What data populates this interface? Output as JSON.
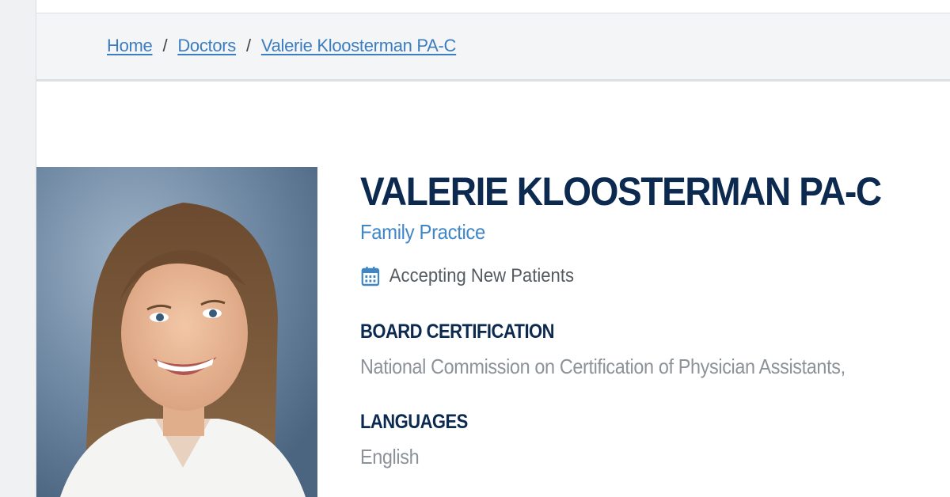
{
  "breadcrumb": {
    "items": [
      "Home",
      "Doctors",
      "Valerie Kloosterman PA-C"
    ],
    "separator": "/"
  },
  "doctor": {
    "name": "VALERIE KLOOSTERMAN PA-C",
    "specialty": "Family Practice",
    "accepting_icon": "calendar-icon",
    "accepting_text": "Accepting New Patients"
  },
  "board_certification": {
    "heading": "BOARD CERTIFICATION",
    "value": "National Commission on Certification of Physician Assistants,"
  },
  "languages": {
    "heading": "LANGUAGES",
    "value": "English"
  },
  "colors": {
    "heading_navy": "#0c2a4f",
    "link_blue": "#3c7dbf",
    "specialty_blue": "#3f86c6",
    "muted_gray": "#8d9298"
  }
}
